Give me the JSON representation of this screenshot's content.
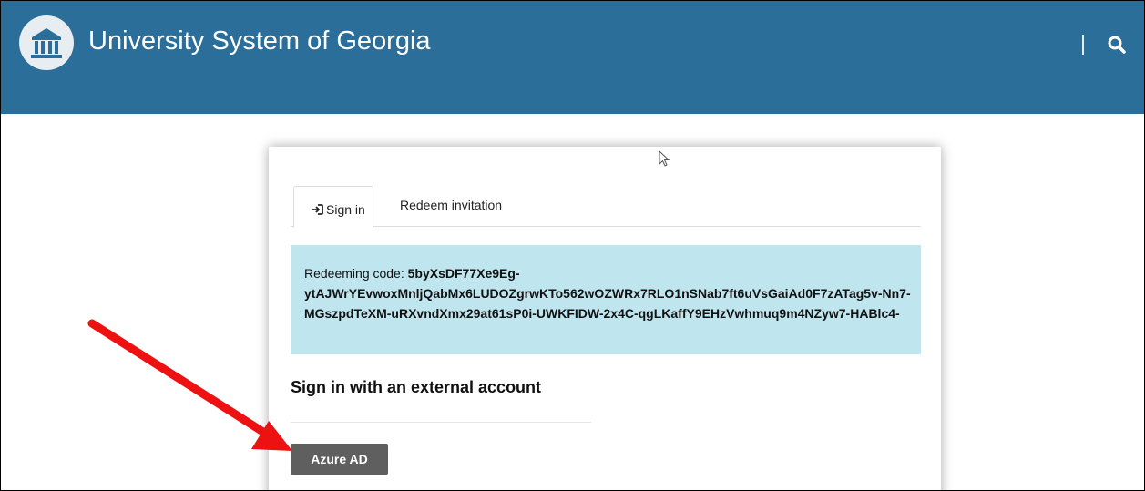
{
  "header": {
    "title": "University System of Georgia",
    "logo_icon": "university-building-icon",
    "search_icon": "search-icon",
    "background": "#2c6e9a"
  },
  "tabs": [
    {
      "label": "Sign in",
      "icon": "sign-in-icon",
      "active": true
    },
    {
      "label": "Redeem invitation",
      "active": false
    }
  ],
  "notice": {
    "prefix": "Redeeming code: ",
    "code": "5byXsDF77Xe9Eg-ytAJWrYEvwoxMnljQabMx6LUDOZgrwKTo562wOZWRx7RLO1nSNab7ft6uVsGaiAd0F7zATag5v-Nn7-MGszpdTeXM-uRXvndXmx29at61sP0i-UWKFIDW-2x4C-qgLKaffY9EHzVwhmuq9m4NZyw7-HABlc4-",
    "background": "#bfe6ef"
  },
  "external": {
    "heading": "Sign in with an external account",
    "button_label": "Azure AD"
  },
  "annotation": {
    "arrow_color": "#ee1111"
  }
}
